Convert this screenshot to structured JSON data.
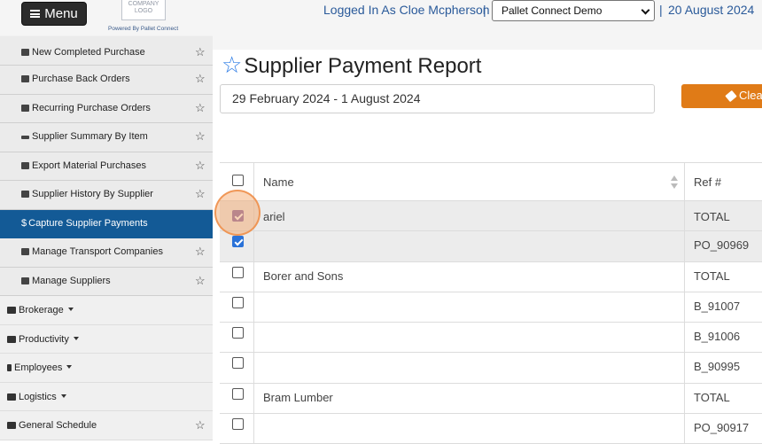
{
  "header": {
    "menu_label": "Menu",
    "logo_text": "COMPANY LOGO",
    "powered_by": "Powered By Pallet Connect",
    "logged_in": "Logged In As Cloe Mcpherson",
    "separator": "|",
    "company_select": "Pallet Connect Demo",
    "date": "20 August 2024"
  },
  "sidebar": {
    "sub_items": [
      {
        "label": "New Completed Purchase",
        "icon": "truck-icon"
      },
      {
        "label": "Purchase Back Orders",
        "icon": "clipboard-icon"
      },
      {
        "label": "Recurring Purchase Orders",
        "icon": "sync-icon"
      },
      {
        "label": "Supplier Summary By Item",
        "icon": "pallet-icon"
      },
      {
        "label": "Export Material Purchases",
        "icon": "export-icon"
      },
      {
        "label": "Supplier History By Supplier",
        "icon": "chart-icon"
      },
      {
        "label": "Capture Supplier Payments",
        "icon": "dollar-icon",
        "active": true
      },
      {
        "label": "Manage Transport Companies",
        "icon": "truck-icon"
      },
      {
        "label": "Manage Suppliers",
        "icon": "users-icon"
      }
    ],
    "main_items": [
      {
        "label": "Brokerage",
        "icon": "truck-icon"
      },
      {
        "label": "Productivity",
        "icon": "hammer-icon"
      },
      {
        "label": "Employees",
        "icon": "person-icon"
      },
      {
        "label": "Logistics",
        "icon": "truck-icon"
      },
      {
        "label": "General Schedule",
        "icon": "calendar-icon"
      }
    ]
  },
  "main": {
    "title": "Supplier Payment Report",
    "date_range": "29 February 2024 - 1 August 2024",
    "clear_label": "Clear",
    "table": {
      "headers": {
        "name": "Name",
        "ref": "Ref #"
      },
      "rows": [
        {
          "name": "ariel",
          "ref": "TOTAL",
          "checked": true
        },
        {
          "name": "",
          "ref": "PO_90969",
          "checked": true
        },
        {
          "name": "Borer and Sons",
          "ref": "TOTAL",
          "checked": false
        },
        {
          "name": "",
          "ref": "B_91007",
          "checked": false
        },
        {
          "name": "",
          "ref": "B_91006",
          "checked": false
        },
        {
          "name": "",
          "ref": "B_90995",
          "checked": false
        },
        {
          "name": "Bram Lumber",
          "ref": "TOTAL",
          "checked": false
        },
        {
          "name": "",
          "ref": "PO_90917",
          "checked": false
        }
      ]
    }
  },
  "colors": {
    "active_nav": "#135a96",
    "clear_button": "#e07b17",
    "checkbox_checked": "#2a72d8",
    "title_star": "#2c7be5"
  }
}
